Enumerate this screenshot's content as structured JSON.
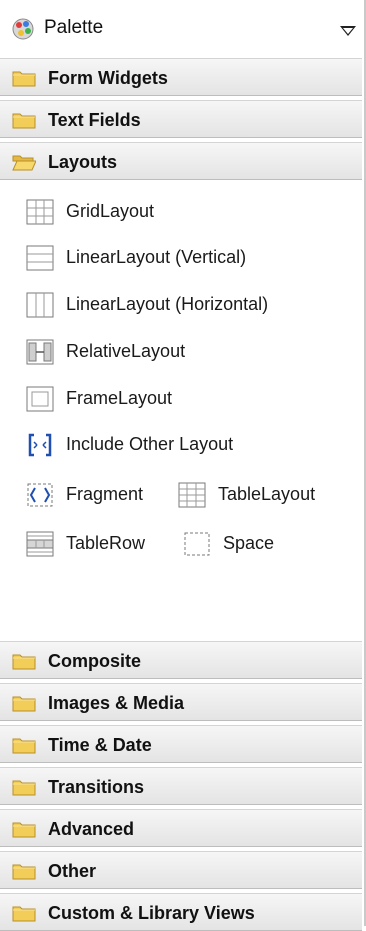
{
  "header": {
    "title": "Palette"
  },
  "categories_top": [
    {
      "label": "Form Widgets",
      "state": "collapsed"
    },
    {
      "label": "Text Fields",
      "state": "collapsed"
    },
    {
      "label": "Layouts",
      "state": "expanded"
    }
  ],
  "layout_items": [
    {
      "label": "GridLayout",
      "icon": "grid-layout-icon"
    },
    {
      "label": "LinearLayout (Vertical)",
      "icon": "linear-vertical-icon"
    },
    {
      "label": "LinearLayout (Horizontal)",
      "icon": "linear-horizontal-icon"
    },
    {
      "label": "RelativeLayout",
      "icon": "relative-layout-icon"
    },
    {
      "label": "FrameLayout",
      "icon": "frame-layout-icon"
    },
    {
      "label": "Include Other Layout",
      "icon": "include-layout-icon"
    },
    {
      "label": "Fragment",
      "icon": "fragment-icon"
    },
    {
      "label": "TableLayout",
      "icon": "table-layout-icon"
    },
    {
      "label": "TableRow",
      "icon": "table-row-icon"
    },
    {
      "label": "Space",
      "icon": "space-icon"
    }
  ],
  "categories_bottom": [
    {
      "label": "Composite"
    },
    {
      "label": "Images & Media"
    },
    {
      "label": "Time & Date"
    },
    {
      "label": "Transitions"
    },
    {
      "label": "Advanced"
    },
    {
      "label": "Other"
    },
    {
      "label": "Custom & Library Views"
    }
  ],
  "colors": {
    "folder": "#f0c850",
    "folder_edge": "#b8902a",
    "icon_stroke": "#7a7a7a"
  }
}
